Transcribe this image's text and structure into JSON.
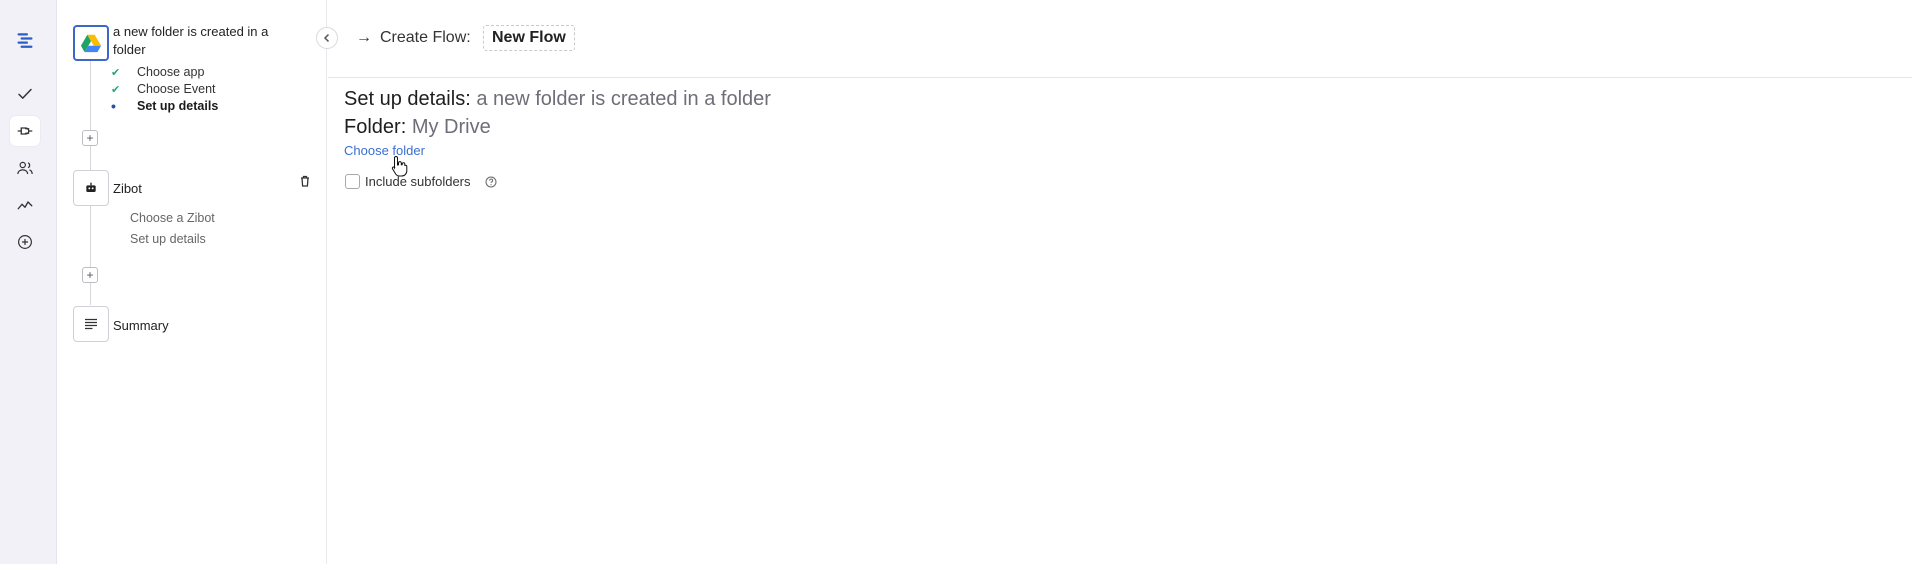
{
  "header": {
    "create_label": "Create Flow:",
    "flow_name": "New Flow"
  },
  "steps": {
    "trigger": {
      "title": "a new folder is created in a folder",
      "app_icon": "google-drive-icon",
      "substeps": [
        {
          "label": "Choose app",
          "state": "done"
        },
        {
          "label": "Choose Event",
          "state": "done"
        },
        {
          "label": "Set up details",
          "state": "current"
        }
      ]
    },
    "action": {
      "title": "Zibot",
      "app_icon": "robot-icon",
      "substeps": [
        {
          "label": "Choose a Zibot"
        },
        {
          "label": "Set up details"
        }
      ]
    },
    "summary": {
      "title": "Summary"
    },
    "add_label": "+"
  },
  "main": {
    "setup_prefix": "Set up details:",
    "setup_value": "a new folder is created in a folder",
    "folder_prefix": "Folder:",
    "folder_value": "My Drive",
    "choose_folder": "Choose folder",
    "include_subfolders": "Include subfolders"
  },
  "colors": {
    "accent": "#3e66c8",
    "link": "#3a6fd1",
    "check": "#2aa37a",
    "rail_bg": "#f3f1f8"
  }
}
